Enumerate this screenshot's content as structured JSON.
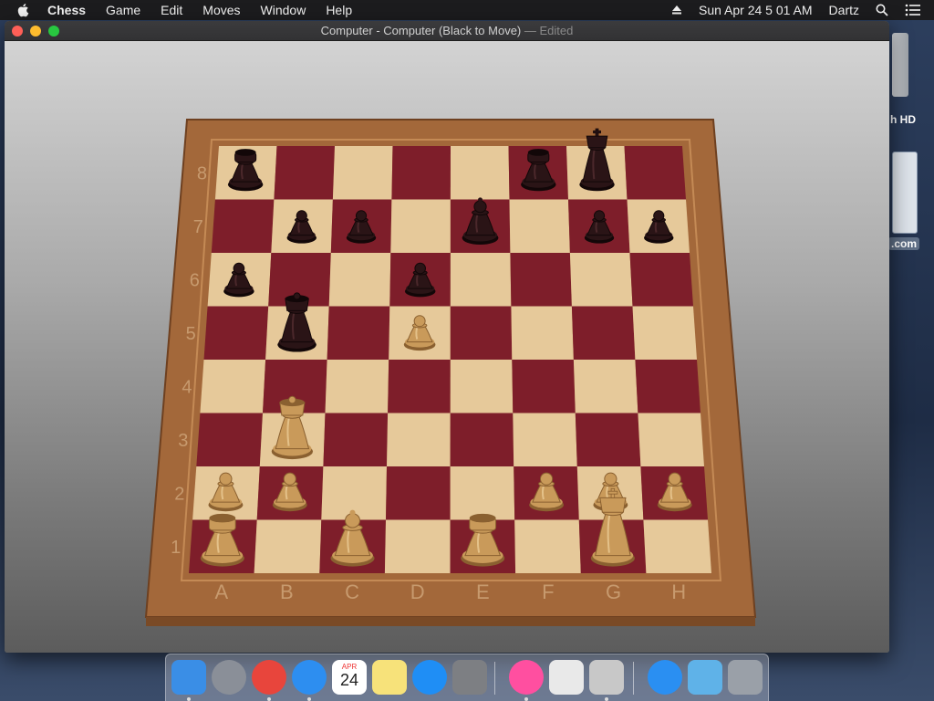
{
  "menubar": {
    "app_name": "Chess",
    "items": [
      "Game",
      "Edit",
      "Moves",
      "Window",
      "Help"
    ],
    "clock": "Sun Apr 24  5 01 AM",
    "user": "Dartz"
  },
  "window": {
    "title": "Computer - Computer   (Black to Move)",
    "edited": "— Edited"
  },
  "board": {
    "files": [
      "A",
      "B",
      "C",
      "D",
      "E",
      "F",
      "G",
      "H"
    ],
    "ranks": [
      "8",
      "7",
      "6",
      "5",
      "4",
      "3",
      "2",
      "1"
    ],
    "light_color": "#e6c99a",
    "dark_color": "#7e1e2a",
    "frame_color": "#a3683a",
    "pieces": [
      {
        "color": "black",
        "type": "rook",
        "square": "a8"
      },
      {
        "color": "black",
        "type": "rook",
        "square": "f8"
      },
      {
        "color": "black",
        "type": "king",
        "square": "g8"
      },
      {
        "color": "black",
        "type": "pawn",
        "square": "b7"
      },
      {
        "color": "black",
        "type": "pawn",
        "square": "c7"
      },
      {
        "color": "black",
        "type": "bishop",
        "square": "e7"
      },
      {
        "color": "black",
        "type": "pawn",
        "square": "g7"
      },
      {
        "color": "black",
        "type": "pawn",
        "square": "h7"
      },
      {
        "color": "black",
        "type": "pawn",
        "square": "a6"
      },
      {
        "color": "black",
        "type": "pawn",
        "square": "d6"
      },
      {
        "color": "black",
        "type": "queen",
        "square": "b5"
      },
      {
        "color": "white",
        "type": "pawn",
        "square": "d5"
      },
      {
        "color": "white",
        "type": "queen",
        "square": "b3"
      },
      {
        "color": "white",
        "type": "pawn",
        "square": "a2"
      },
      {
        "color": "white",
        "type": "pawn",
        "square": "b2"
      },
      {
        "color": "white",
        "type": "pawn",
        "square": "f2"
      },
      {
        "color": "white",
        "type": "pawn",
        "square": "g2"
      },
      {
        "color": "white",
        "type": "pawn",
        "square": "h2"
      },
      {
        "color": "white",
        "type": "rook",
        "square": "a1"
      },
      {
        "color": "white",
        "type": "bishop",
        "square": "c1"
      },
      {
        "color": "white",
        "type": "rook",
        "square": "e1"
      },
      {
        "color": "white",
        "type": "king",
        "square": "g1"
      }
    ]
  },
  "desktop": {
    "drive_label": "h HD",
    "file_label": ".com"
  },
  "dock": {
    "apps": [
      {
        "icon": "finder-icon",
        "color": "#3a8ee6"
      },
      {
        "icon": "launchpad-icon",
        "color": "#8a8f98"
      },
      {
        "icon": "chrome-icon",
        "color": "#e8453c"
      },
      {
        "icon": "safari-icon",
        "color": "#2d8ef0"
      },
      {
        "icon": "calendar-icon",
        "color": "#ffffff",
        "month": "APR",
        "day": "24"
      },
      {
        "icon": "notes-icon",
        "color": "#f7e27a"
      },
      {
        "icon": "app-store-icon",
        "color": "#1f8ef5"
      },
      {
        "icon": "system-preferences-icon",
        "color": "#7d7f83"
      },
      {
        "icon": "itunes-icon",
        "color": "#ff4fa0"
      },
      {
        "icon": "script-editor-icon",
        "color": "#e9e9e9"
      },
      {
        "icon": "chess-icon",
        "color": "#c8c8c8"
      },
      {
        "icon": "app-store-downloads-icon",
        "color": "#2a8ff2"
      },
      {
        "icon": "folder-icon",
        "color": "#5fb2e8"
      },
      {
        "icon": "trash-icon",
        "color": "#9aa0a8"
      }
    ]
  }
}
